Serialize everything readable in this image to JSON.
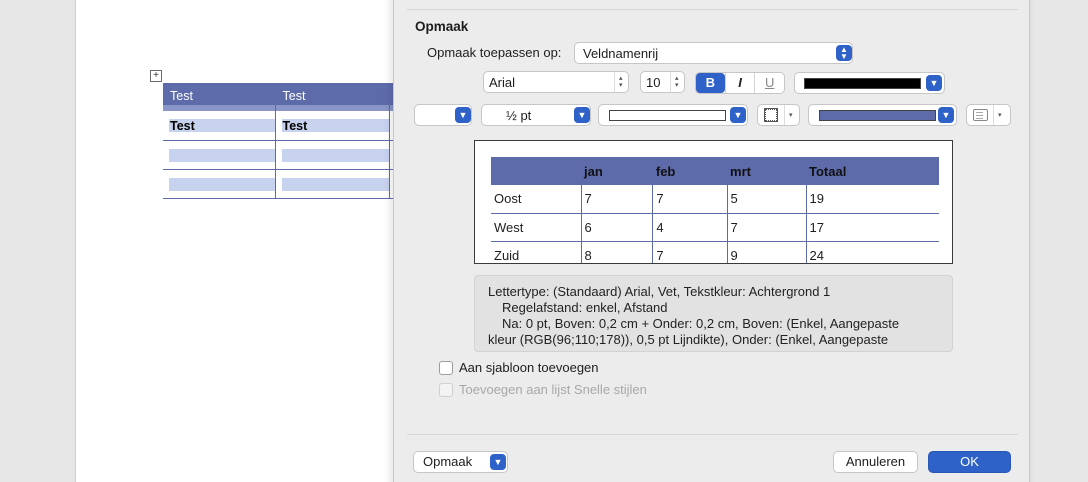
{
  "document": {
    "table": {
      "header": [
        "Test",
        "Test"
      ],
      "first_row": [
        "Test",
        "Test"
      ]
    }
  },
  "dialog": {
    "section_title": "Opmaak",
    "apply_to": {
      "label": "Opmaak toepassen op:",
      "value": "Veldnamenrij"
    },
    "font": {
      "family": "Arial",
      "size": "10",
      "bold": "B",
      "italic": "I",
      "underline": "U",
      "text_color": "#000000"
    },
    "border": {
      "style": "",
      "width": "½ pt",
      "line_color": "#ffffff",
      "shading_color": "#5d6bab"
    },
    "preview": {
      "columns": [
        "",
        "jan",
        "feb",
        "mrt",
        "Totaal"
      ],
      "rows": [
        [
          "Oost",
          "7",
          "7",
          "5",
          "19"
        ],
        [
          "West",
          "6",
          "4",
          "7",
          "17"
        ],
        [
          "Zuid",
          "8",
          "7",
          "9",
          "24"
        ]
      ]
    },
    "description": [
      "Lettertype: (Standaard) Arial, Vet, Tekstkleur: Achtergrond 1",
      "Regelafstand:  enkel, Afstand",
      "Na:  0 pt, Boven:  0,2 cm + Onder:  0,2 cm, Boven: (Enkel, Aangepaste",
      "kleur (RGB(96;110;178)),  0,5 pt Lijndikte), Onder: (Enkel, Aangepaste"
    ],
    "checkboxes": {
      "add_to_template": {
        "label": "Aan sjabloon toevoegen",
        "checked": false,
        "enabled": true
      },
      "add_to_quick_styles": {
        "label": "Toevoegen aan lijst Snelle stijlen",
        "checked": false,
        "enabled": false
      }
    },
    "footer": {
      "format_button": "Opmaak",
      "cancel": "Annuleren",
      "ok": "OK"
    }
  },
  "colors": {
    "accent": "#2f62c9",
    "table_header": "#5d6bab",
    "table_band": "#c7d2ee"
  }
}
